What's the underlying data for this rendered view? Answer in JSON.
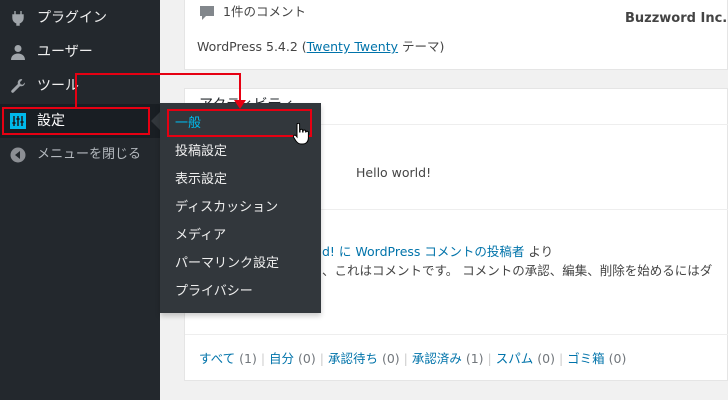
{
  "watermark": "Buzzword Inc.",
  "sidebar": {
    "items": [
      {
        "label": "プラグイン",
        "icon": "plugin-icon"
      },
      {
        "label": "ユーザー",
        "icon": "user-icon"
      },
      {
        "label": "ツール",
        "icon": "wrench-icon"
      },
      {
        "label": "設定",
        "icon": "settings-icon"
      },
      {
        "label": "メニューを閉じる",
        "icon": "collapse-menu-icon"
      }
    ]
  },
  "flyout": {
    "items": [
      "一般",
      "投稿設定",
      "表示設定",
      "ディスカッション",
      "メディア",
      "パーマリンク設定",
      "プライバシー"
    ]
  },
  "glance": {
    "comments": "1件のコメント",
    "wp_prefix": "WordPress 5.4.2 (",
    "theme": "Twenty Twenty",
    "theme_suffix": " テーマ)"
  },
  "activity": {
    "title": "アクティビティ",
    "post_link": "Hello world!",
    "comment_author_fragment": "d! に",
    "comment_post_link": "WordPress コメントの投稿者",
    "comment_suffix": "より",
    "comment_body": "、これはコメントです。 コメントの承認、編集、削除を始めるにはダ"
  },
  "filters": [
    {
      "label": "すべて",
      "count": "(1)"
    },
    {
      "label": "自分",
      "count": "(0)"
    },
    {
      "label": "承認待ち",
      "count": "(0)"
    },
    {
      "label": "承認済み",
      "count": "(1)"
    },
    {
      "label": "スパム",
      "count": "(0)"
    },
    {
      "label": "ゴミ箱",
      "count": "(0)"
    }
  ],
  "colors": {
    "accent": "#0073aa",
    "highlight": "#e60012",
    "sidebar": "#23282d"
  }
}
